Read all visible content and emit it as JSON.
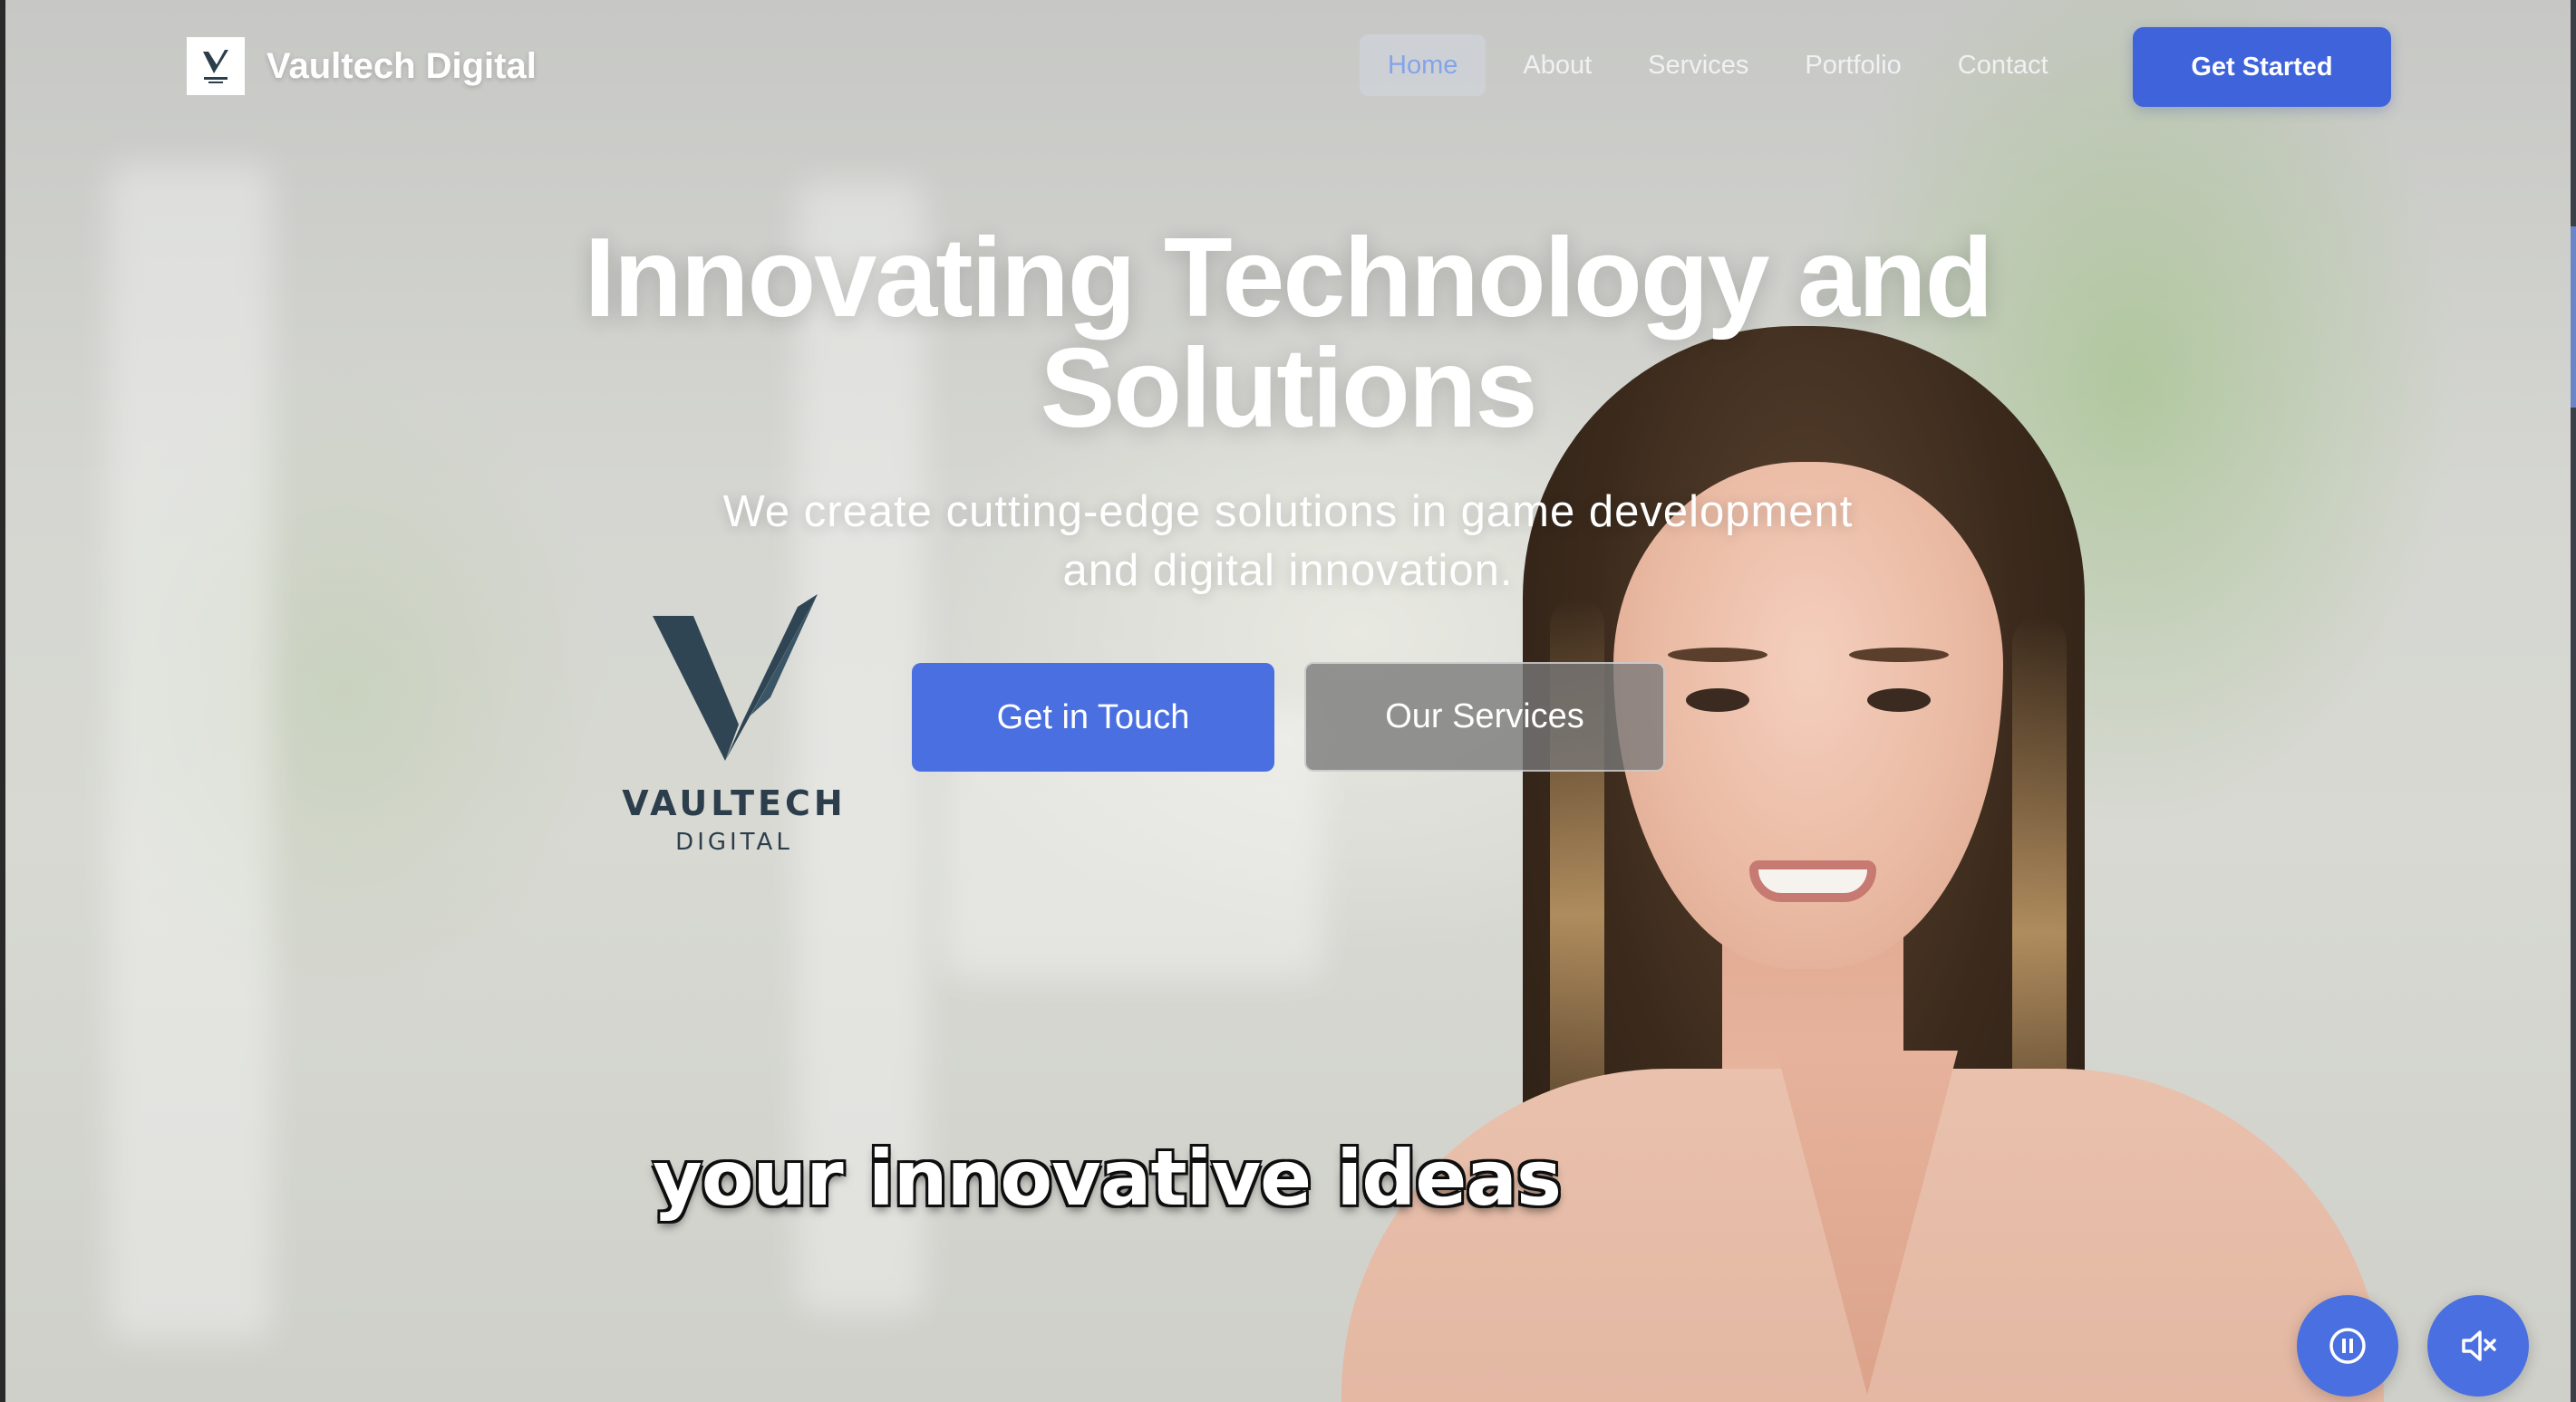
{
  "header": {
    "brand_name": "Vaultech Digital",
    "nav": {
      "home": "Home",
      "about": "About",
      "services": "Services",
      "portfolio": "Portfolio",
      "contact": "Contact"
    },
    "cta_label": "Get Started"
  },
  "hero": {
    "title_line1": "Innovating Technology and",
    "title_line2": "Solutions",
    "subtitle_line1": "We create cutting-edge solutions in game development",
    "subtitle_line2": "and digital innovation.",
    "primary_button": "Get in Touch",
    "secondary_button": "Our Services"
  },
  "video": {
    "logo_word1": "VAULTECH",
    "logo_word2": "DIGITAL",
    "caption": "your innovative ideas",
    "controls": {
      "pause_icon": "pause-icon",
      "mute_icon": "volume-muted-icon"
    }
  },
  "colors": {
    "accent": "#3f63db",
    "active_nav": "#7ea1ee",
    "logo_dark": "#2c3e4c"
  }
}
